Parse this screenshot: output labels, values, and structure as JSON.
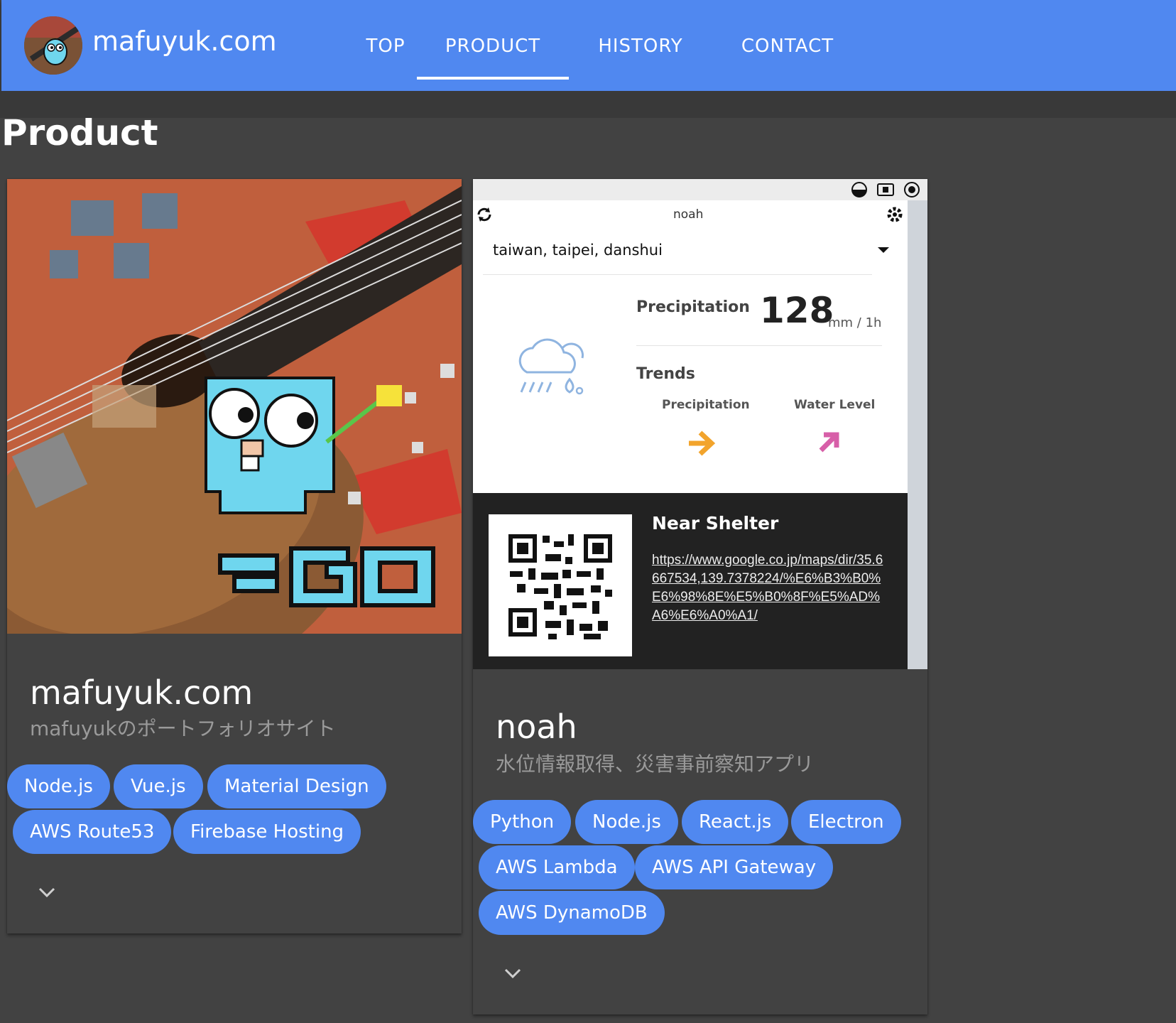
{
  "header": {
    "site_title": "mafuyuk.com",
    "nav": [
      {
        "label": "TOP",
        "active": false
      },
      {
        "label": "PRODUCT",
        "active": true
      },
      {
        "label": "HISTORY",
        "active": false
      },
      {
        "label": "CONTACT",
        "active": false
      }
    ]
  },
  "page": {
    "title": "Product"
  },
  "colors": {
    "accent": "#5088f0",
    "background": "#424242"
  },
  "products": [
    {
      "title": "mafuyuk.com",
      "subtitle": "mafuyukのポートフォリオサイト",
      "image": "guitar-gopher-go-image",
      "tags": [
        "Node.js",
        "Vue.js",
        "Material Design",
        "AWS Route53",
        "Firebase Hosting"
      ],
      "expand_icon": "chevron-down-icon"
    },
    {
      "title": "noah",
      "subtitle": "水位情報取得、災害事前察知アプリ",
      "tags": [
        "Python",
        "Node.js",
        "React.js",
        "Electron",
        "AWS Lambda",
        "AWS API Gateway",
        "AWS DynamoDB"
      ],
      "expand_icon": "chevron-down-icon",
      "screenshot": {
        "window_title": "noah",
        "location": "taiwan, taipei, danshui",
        "precipitation_label": "Precipitation",
        "precipitation_value": "128",
        "precipitation_unit": "mm / 1h",
        "trends_label": "Trends",
        "trend_precipitation_label": "Precipitation",
        "trend_water_label": "Water Level",
        "shelter_title": "Near Shelter",
        "shelter_link": "https://www.google.co.jp/maps/dir/35.6667534,139.7378224/%E6%B3%B0%E6%98%8E%E5%B0%8F%E5%AD%A6%E6%A0%A1/"
      }
    }
  ]
}
